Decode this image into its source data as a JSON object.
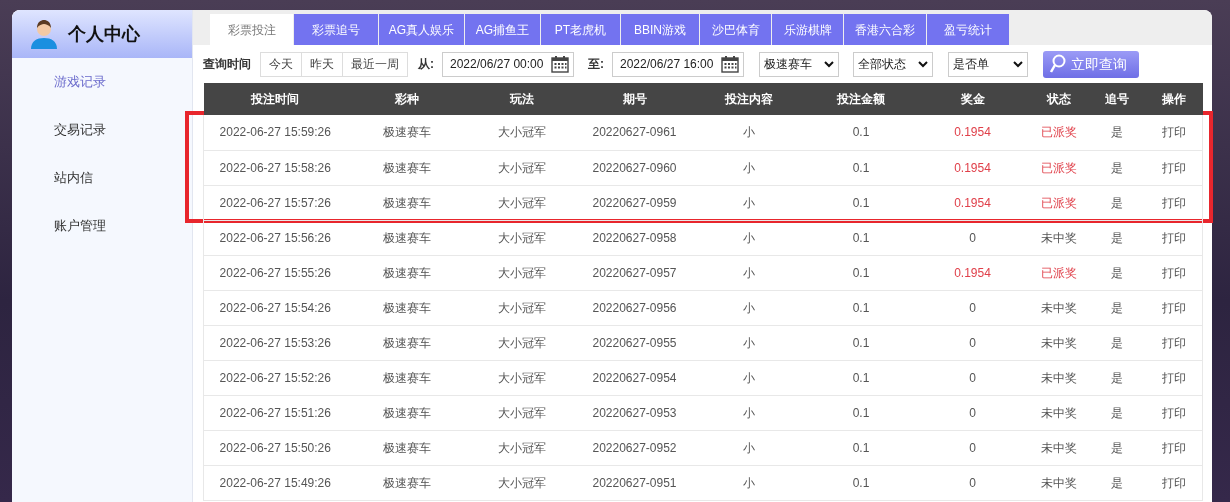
{
  "sidebar": {
    "title": "个人中心",
    "items": [
      {
        "label": "游戏记录",
        "selected": true
      },
      {
        "label": "交易记录",
        "selected": false
      },
      {
        "label": "站内信",
        "selected": false
      },
      {
        "label": "账户管理",
        "selected": false
      }
    ]
  },
  "tabs": [
    {
      "label": "彩票投注",
      "selected": true
    },
    {
      "label": "彩票追号",
      "selected": false
    },
    {
      "label": "AG真人娱乐",
      "selected": false
    },
    {
      "label": "AG捕鱼王",
      "selected": false
    },
    {
      "label": "PT老虎机",
      "selected": false
    },
    {
      "label": "BBIN游戏",
      "selected": false
    },
    {
      "label": "沙巴体育",
      "selected": false
    },
    {
      "label": "乐游棋牌",
      "selected": false
    },
    {
      "label": "香港六合彩",
      "selected": false
    },
    {
      "label": "盈亏统计",
      "selected": false
    }
  ],
  "filter": {
    "label": "查询时间",
    "quick": [
      "今天",
      "昨天",
      "最近一周"
    ],
    "from_label": "从:",
    "from": "2022/06/27 00:00",
    "to_label": "至:",
    "to": "2022/06/27 16:00",
    "selects": [
      "极速赛车",
      "全部状态",
      "是否单"
    ],
    "search_button": "立即查询"
  },
  "table": {
    "columns": [
      "投注时间",
      "彩种",
      "玩法",
      "期号",
      "投注内容",
      "投注金额",
      "奖金",
      "状态",
      "追号",
      "操作"
    ],
    "row_groups": [
      {
        "highlighted": true,
        "rows": [
          {
            "cells": [
              "2022-06-27 15:59:26",
              "极速赛车",
              "大小冠军",
              "20220627-0961",
              "小",
              "0.1",
              "0.1954",
              "已派奖",
              "是",
              "打印"
            ],
            "won": true
          },
          {
            "cells": [
              "2022-06-27 15:58:26",
              "极速赛车",
              "大小冠军",
              "20220627-0960",
              "小",
              "0.1",
              "0.1954",
              "已派奖",
              "是",
              "打印"
            ],
            "won": true
          },
          {
            "cells": [
              "2022-06-27 15:57:26",
              "极速赛车",
              "大小冠军",
              "20220627-0959",
              "小",
              "0.1",
              "0.1954",
              "已派奖",
              "是",
              "打印"
            ],
            "won": true
          }
        ]
      },
      {
        "highlighted": false,
        "rows": [
          {
            "cells": [
              "2022-06-27 15:56:26",
              "极速赛车",
              "大小冠军",
              "20220627-0958",
              "小",
              "0.1",
              "0",
              "未中奖",
              "是",
              "打印"
            ],
            "won": false
          },
          {
            "cells": [
              "2022-06-27 15:55:26",
              "极速赛车",
              "大小冠军",
              "20220627-0957",
              "小",
              "0.1",
              "0.1954",
              "已派奖",
              "是",
              "打印"
            ],
            "won": true
          },
          {
            "cells": [
              "2022-06-27 15:54:26",
              "极速赛车",
              "大小冠军",
              "20220627-0956",
              "小",
              "0.1",
              "0",
              "未中奖",
              "是",
              "打印"
            ],
            "won": false
          },
          {
            "cells": [
              "2022-06-27 15:53:26",
              "极速赛车",
              "大小冠军",
              "20220627-0955",
              "小",
              "0.1",
              "0",
              "未中奖",
              "是",
              "打印"
            ],
            "won": false
          },
          {
            "cells": [
              "2022-06-27 15:52:26",
              "极速赛车",
              "大小冠军",
              "20220627-0954",
              "小",
              "0.1",
              "0",
              "未中奖",
              "是",
              "打印"
            ],
            "won": false
          },
          {
            "cells": [
              "2022-06-27 15:51:26",
              "极速赛车",
              "大小冠军",
              "20220627-0953",
              "小",
              "0.1",
              "0",
              "未中奖",
              "是",
              "打印"
            ],
            "won": false
          },
          {
            "cells": [
              "2022-06-27 15:50:26",
              "极速赛车",
              "大小冠军",
              "20220627-0952",
              "小",
              "0.1",
              "0",
              "未中奖",
              "是",
              "打印"
            ],
            "won": false
          },
          {
            "cells": [
              "2022-06-27 15:49:26",
              "极速赛车",
              "大小冠军",
              "20220627-0951",
              "小",
              "0.1",
              "0",
              "未中奖",
              "是",
              "打印"
            ],
            "won": false
          }
        ]
      }
    ]
  }
}
